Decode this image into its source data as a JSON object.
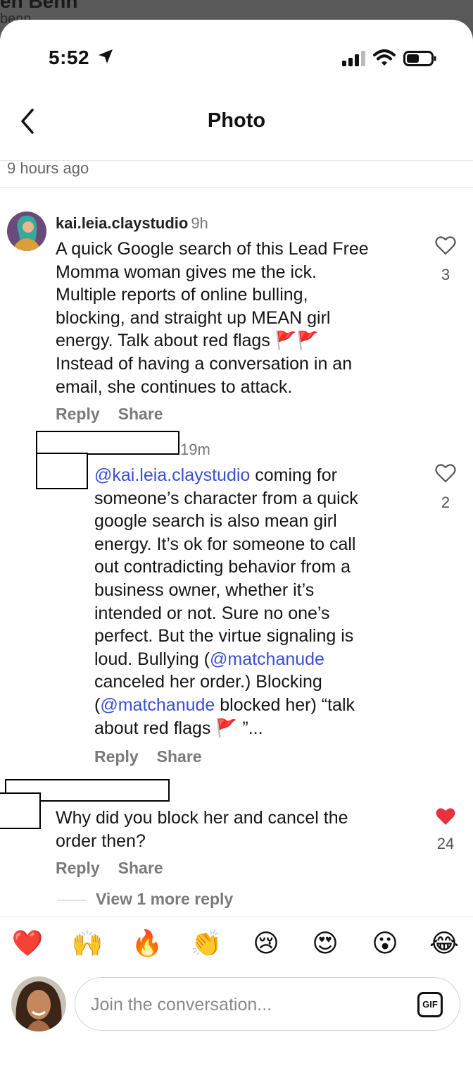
{
  "status_bar": {
    "time": "5:52"
  },
  "header": {
    "title": "Photo"
  },
  "post": {
    "time_ago": "9 hours ago"
  },
  "comments": [
    {
      "username": "kai.leia.claystudio",
      "age": "9h",
      "lines": [
        "A quick Google search of this Lead Free",
        "Momma woman gives me the ick.",
        "Multiple reports of online bulling,",
        "blocking, and straight up MEAN girl",
        "energy.  Talk about red flags 🚩🚩",
        "Instead of having a conversation in an",
        "email, she continues to attack."
      ],
      "likes": "3",
      "liked": false,
      "reply_label": "Reply",
      "share_label": "Share"
    },
    {
      "username": "",
      "age": "19m",
      "mention": "@kai.leia.claystudio",
      "lines": [
        " coming for",
        "someone’s character from a quick",
        "google search is also mean girl",
        "energy. It’s ok for someone to call",
        "out contradicting behavior from a",
        "business owner, whether it’s",
        "intended or not. Sure no one’s",
        "perfect. But the virtue signaling is",
        "loud. Bullying (",
        "@matchanude",
        "canceled her order.) Blocking",
        "(",
        "@matchanude",
        " blocked her) “talk",
        "about red flags 🚩 ”..."
      ],
      "likes": "2",
      "liked": false,
      "reply_label": "Reply",
      "share_label": "Share"
    },
    {
      "username": "",
      "lines": [
        "Why did you block her and cancel the",
        "order then?"
      ],
      "likes": "24",
      "liked": true,
      "reply_label": "Reply",
      "share_label": "Share"
    }
  ],
  "view_more": "View 1 more reply",
  "reactions": [
    {
      "emoji": "❤️",
      "icon": "red-heart"
    },
    {
      "emoji": "🙌",
      "icon": "raising-hands"
    },
    {
      "emoji": "🔥",
      "icon": "fire"
    },
    {
      "emoji": "👏",
      "icon": "clapping-hands"
    },
    {
      "emoji": "😢",
      "icon": "crying-face"
    },
    {
      "emoji": "😍",
      "icon": "heart-eyes"
    },
    {
      "emoji": "😮",
      "icon": "surprised-face"
    },
    {
      "emoji": "😂",
      "icon": "laughing-face"
    }
  ],
  "composer": {
    "placeholder": "Join the conversation...",
    "gif_label": "GIF"
  },
  "colors": {
    "mention": "#3b4fd4",
    "liked_heart": "#e8313f",
    "muted": "#7a7a7a"
  }
}
